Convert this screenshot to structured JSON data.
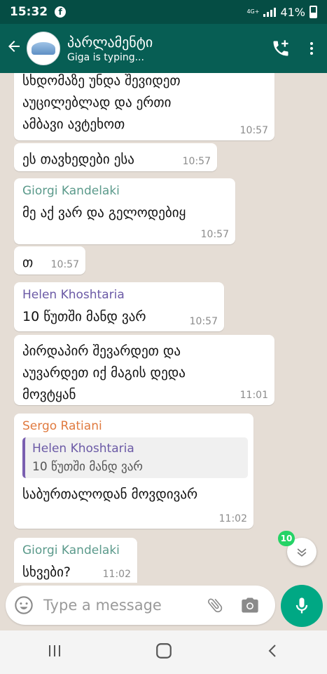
{
  "status_bar": {
    "time": "15:32",
    "network": "4G+",
    "battery": "41%"
  },
  "header": {
    "title": "პარლამენტი",
    "subtitle": "Giga is typing..."
  },
  "messages": [
    {
      "sender": "",
      "text": "სხდომაზე უნდა შევიდეთ\nაუცილებლად და ერთი\nამბავი ავტეხოთ",
      "time": "10:57"
    },
    {
      "sender": "",
      "text": "ეს თავხედები ესა",
      "time": "10:57"
    },
    {
      "sender": "Giorgi Kandelaki",
      "sender_color": "#5b9a8b",
      "text": "მე აქ ვარ და გელოდებიყ",
      "time": "10:57"
    },
    {
      "sender": "",
      "text": "თ",
      "time": "10:57"
    },
    {
      "sender": "Helen Khoshtaria",
      "sender_color": "#6b5aa6",
      "text": "10 წუთში მანდ ვარ",
      "time": "10:57"
    },
    {
      "sender": "",
      "text": "პირდაპირ შევარდეთ და\nაუვარდეთ იქ მაგის დედა\nმოვტყან",
      "time": "11:01"
    },
    {
      "sender": "Sergo Ratiani",
      "sender_color": "#e07a3f",
      "quote_sender": "Helen Khoshtaria",
      "quote_text": "10 წუთში მანდ ვარ",
      "text": "საბურთალოდან მოვდივარ",
      "time": "11:02"
    },
    {
      "sender": "Giorgi Kandelaki",
      "sender_color": "#5b9a8b",
      "text": "სხვები?",
      "time": "11:02"
    }
  ],
  "unread_count": "10",
  "input": {
    "placeholder": "Type a message"
  },
  "colors": {
    "header": "#075e54",
    "status_bar": "#054d44",
    "accent": "#00a884",
    "badge": "#25d366"
  },
  "icons": [
    "back-arrow-icon",
    "add-call-icon",
    "more-vert-icon",
    "emoji-icon",
    "attach-icon",
    "camera-icon",
    "mic-icon",
    "chevron-down-icon",
    "recents-icon",
    "home-icon",
    "nav-back-icon"
  ]
}
